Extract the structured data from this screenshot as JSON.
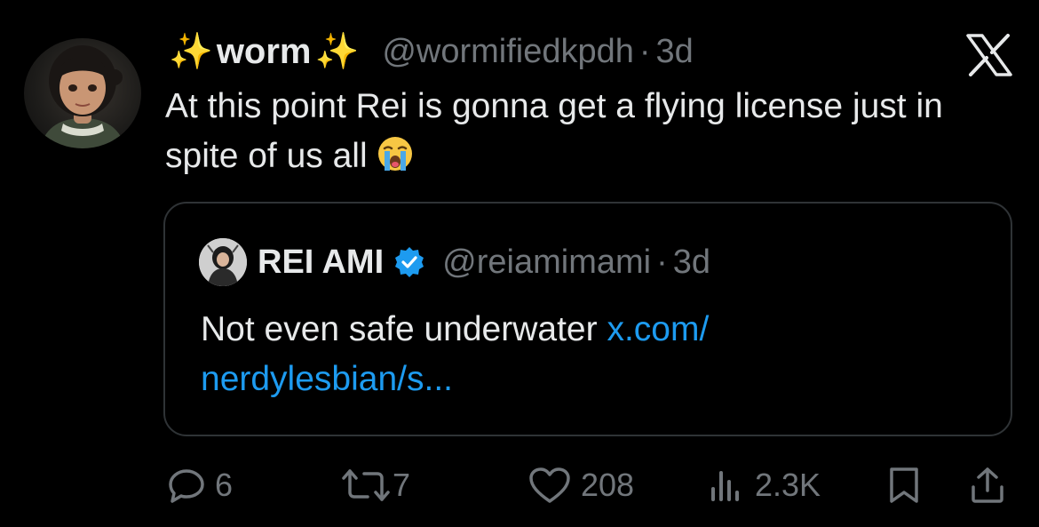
{
  "tweet": {
    "sparkle_left": "✨",
    "display_name": "worm",
    "sparkle_right": "✨",
    "handle": "@wormifiedkpdh",
    "dot": "·",
    "time": "3d",
    "text": "At this point Rei is gonna get a flying license just in spite of us all",
    "emoji": "loudly-crying-face"
  },
  "quote": {
    "display_name": "REI AMI",
    "handle": "@reiamimami",
    "dot": "·",
    "time": "3d",
    "text": "Not even safe underwater ",
    "link_line1": "x.com/",
    "link_line2": "nerdylesbian/s..."
  },
  "actions": {
    "replies": "6",
    "reposts": "7",
    "likes": "208",
    "views": "2.3K"
  },
  "icons": {
    "close": "x-logo-icon",
    "reply": "reply-icon",
    "repost": "repost-icon",
    "like": "heart-icon",
    "views": "views-icon",
    "bookmark": "bookmark-icon",
    "share": "share-icon",
    "verified": "verified-badge-icon"
  },
  "colors": {
    "background": "#000000",
    "text": "#e7e9ea",
    "secondary": "#71767b",
    "link": "#1d9bf0",
    "border": "#2f3336",
    "verified": "#1d9bf0"
  }
}
